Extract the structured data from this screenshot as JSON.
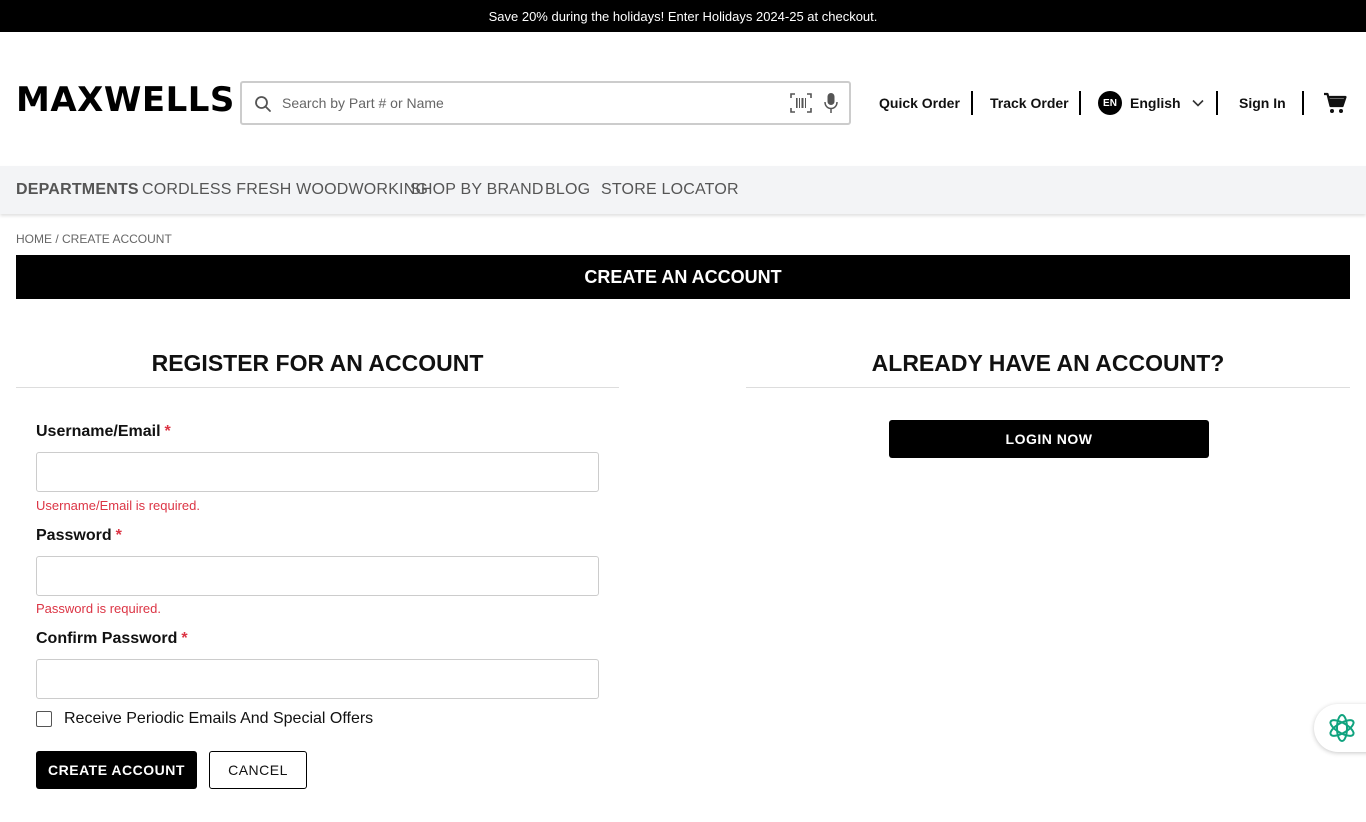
{
  "promo": {
    "text": "Save 20% during the holidays! Enter Holidays 2024-25 at checkout."
  },
  "header": {
    "logo": "MAXWELLS",
    "search_placeholder": "Search by Part # or Name",
    "quick_order": "Quick Order",
    "track_order": "Track Order",
    "lang_code": "EN",
    "lang_label": "English",
    "sign_in": "Sign In"
  },
  "nav": {
    "items": [
      "DEPARTMENTS",
      "CORDLESS FRESH WOODWORKING",
      "SHOP BY BRAND",
      "BLOG",
      "STORE LOCATOR"
    ]
  },
  "breadcrumb": "HOME / CREATE ACCOUNT",
  "banner": "CREATE AN ACCOUNT",
  "register": {
    "title": "REGISTER FOR AN ACCOUNT",
    "username_label": "Username/Email",
    "username_error": "Username/Email is required.",
    "password_label": "Password",
    "password_error": "Password is required.",
    "confirm_label": "Confirm Password",
    "required_mark": "*",
    "optin_label": "Receive Periodic Emails And Special Offers",
    "create_button": "CREATE ACCOUNT",
    "cancel_button": "CANCEL"
  },
  "login": {
    "title": "ALREADY HAVE AN ACCOUNT?",
    "button": "LOGIN NOW"
  },
  "colors": {
    "accent": "#000000",
    "error": "#dc3545",
    "assistant": "#10a37f"
  },
  "icons": [
    "search-icon",
    "barcode-scan-icon",
    "microphone-icon",
    "chevron-down-icon",
    "cart-icon",
    "assistant-icon"
  ]
}
